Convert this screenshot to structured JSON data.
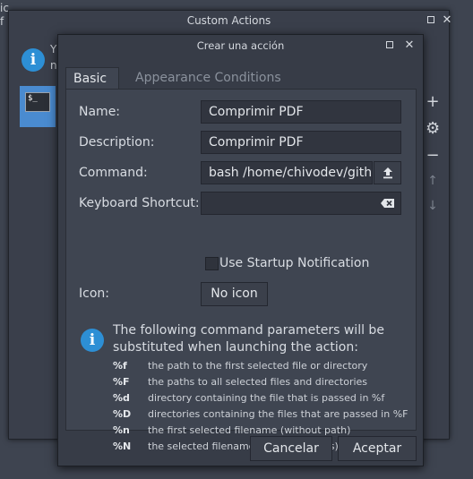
{
  "background": {
    "line1": "ic",
    "line2": "f"
  },
  "outer_window": {
    "title": "Custom Actions",
    "message_line1": "Y",
    "message_line2": "n",
    "action_icon_text": "$_"
  },
  "dialog": {
    "title": "Crear una acción",
    "tabs": [
      "Basic",
      "Appearance Conditions"
    ],
    "name_label": "Name:",
    "name_value": "Comprimir PDF",
    "description_label": "Description:",
    "description_value": "Comprimir PDF",
    "command_label": "Command:",
    "command_value": "bash /home/chivodev/github",
    "shortcut_label": "Keyboard Shortcut:",
    "shortcut_value": "",
    "startup_label": "Use Startup Notification",
    "startup_checked": false,
    "icon_label": "Icon:",
    "icon_button": "No icon",
    "help_heading": "The following command parameters will be substituted when launching the action:",
    "params": [
      {
        "key": "%f",
        "desc": "the path to the first selected file or directory"
      },
      {
        "key": "%F",
        "desc": "the paths to all selected files and directories"
      },
      {
        "key": "%d",
        "desc": "directory containing the file that is passed in %f"
      },
      {
        "key": "%D",
        "desc": "directories containing the files that are passed in %F"
      },
      {
        "key": "%n",
        "desc": "the first selected filename (without path)"
      },
      {
        "key": "%N",
        "desc": "the selected filenames (without paths)"
      }
    ],
    "cancel_label": "Cancelar",
    "accept_label": "Aceptar"
  },
  "colors": {
    "accent": "#2d8fd5",
    "selection": "#4a8bd0",
    "dialog_bg": "#373c47",
    "panel_bg": "#3f4551"
  }
}
